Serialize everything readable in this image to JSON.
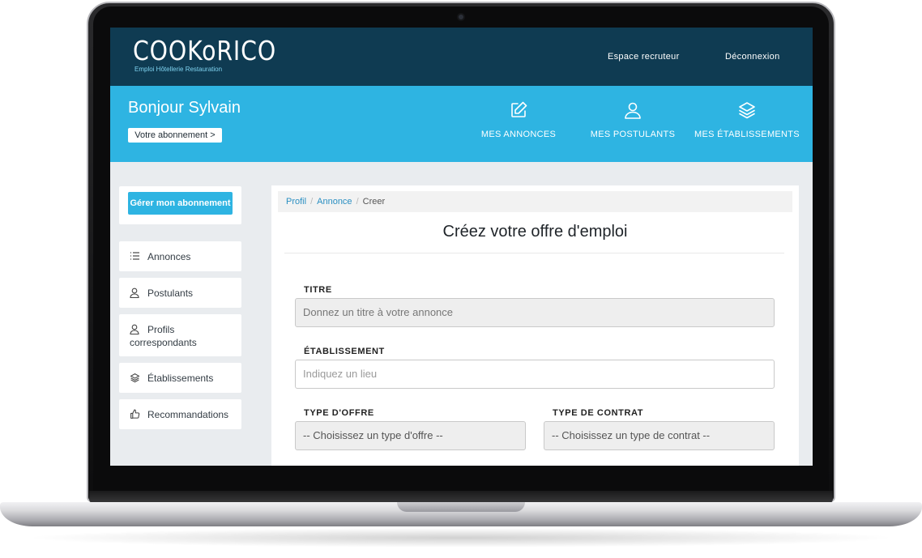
{
  "brand": {
    "logo_text": "COOKoRICO",
    "logo_tagline": "Emploi Hôtellerie Restauration",
    "colors": {
      "dark": "#0f3b52",
      "accent": "#2eb4e2",
      "page_bg": "#e9ecef"
    }
  },
  "topnav": {
    "recruiter_space": "Espace recruteur",
    "logout": "Déconnexion"
  },
  "header": {
    "greeting": "Bonjour Sylvain",
    "subscription_button": "Votre abonnement >",
    "nav": [
      {
        "label": "MES ANNONCES",
        "icon": "edit-icon"
      },
      {
        "label": "MES POSTULANTS",
        "icon": "user-icon"
      },
      {
        "label": "MES ÉTABLISSEMENTS",
        "icon": "layers-icon"
      }
    ]
  },
  "sidebar": {
    "manage_button": "Gérer mon abonnement",
    "items": [
      {
        "label": "Annonces",
        "icon": "list-icon"
      },
      {
        "label": "Postulants",
        "icon": "user-icon"
      },
      {
        "label_line1": "Profils",
        "label_line2": "correspondants",
        "icon": "user-icon"
      },
      {
        "label": "Établissements",
        "icon": "layers-icon"
      },
      {
        "label": "Recommandations",
        "icon": "thumbs-up-icon"
      }
    ]
  },
  "breadcrumb": {
    "items": [
      "Profil",
      "Annonce",
      "Creer"
    ]
  },
  "form": {
    "title": "Créez votre offre d'emploi",
    "titre_label": "TITRE",
    "titre_placeholder": "Donnez un titre à votre annonce",
    "etablissement_label": "ÉTABLISSEMENT",
    "etablissement_placeholder": "Indiquez un lieu",
    "type_offre_label": "TYPE D'OFFRE",
    "type_offre_value": "-- Choisissez un type d'offre --",
    "type_contrat_label": "TYPE DE CONTRAT",
    "type_contrat_value": "-- Choisissez un type de contrat --"
  }
}
